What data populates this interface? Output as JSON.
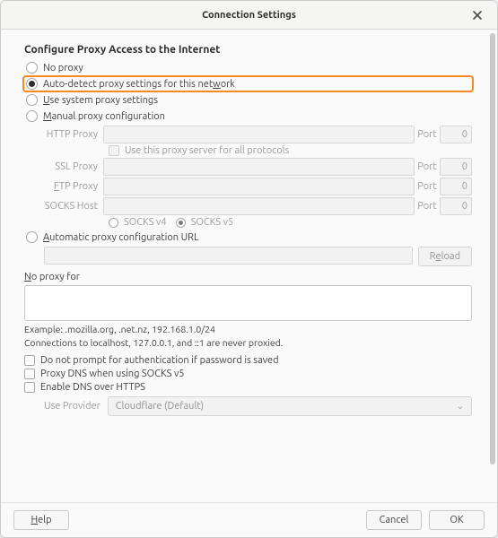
{
  "window": {
    "title": "Connection Settings"
  },
  "section_title": "Configure Proxy Access to the Internet",
  "radios": {
    "no_proxy": "No proxy",
    "auto_detect_pre": "Auto-detect proxy settings for this net",
    "auto_detect_mn": "w",
    "auto_detect_post": "ork",
    "use_system_mn": "U",
    "use_system_post": "se system proxy settings",
    "manual_mn": "M",
    "manual_post": "anual proxy configuration",
    "pac_mn": "A",
    "pac_post": "utomatic proxy configuration URL"
  },
  "proxy": {
    "http_label": "HTTP Proxy",
    "ssl_label": "SSL Proxy",
    "ftp_label_mn": "F",
    "ftp_label_post": "TP Proxy",
    "socks_label": "SOCKS Host",
    "port_label": "Port",
    "port_value": "0",
    "use_for_all": "Use this proxy server for all protocols",
    "socks_v4": "SOCKS v4",
    "socks_v5": "SOCKS v5"
  },
  "pac": {
    "reload_mn": "R",
    "reload_mid": "e",
    "reload_post": "load"
  },
  "no_proxy_for_mn": "N",
  "no_proxy_for_post": "o proxy for",
  "example": "Example: .mozilla.org, .net.nz, 192.168.1.0/24",
  "localhost_note": "Connections to localhost, 127.0.0.1, and ::1 are never proxied.",
  "checks": {
    "no_prompt": "Do not prompt for authentication if password is saved",
    "proxy_dns": "Proxy DNS when using SOCKS v5",
    "enable_doh": "Enable DNS over HTTPS"
  },
  "provider": {
    "label": "Use Provider",
    "value": "Cloudflare (Default)"
  },
  "footer": {
    "help_mn": "H",
    "help_post": "elp",
    "cancel": "Cancel",
    "ok": "OK"
  }
}
